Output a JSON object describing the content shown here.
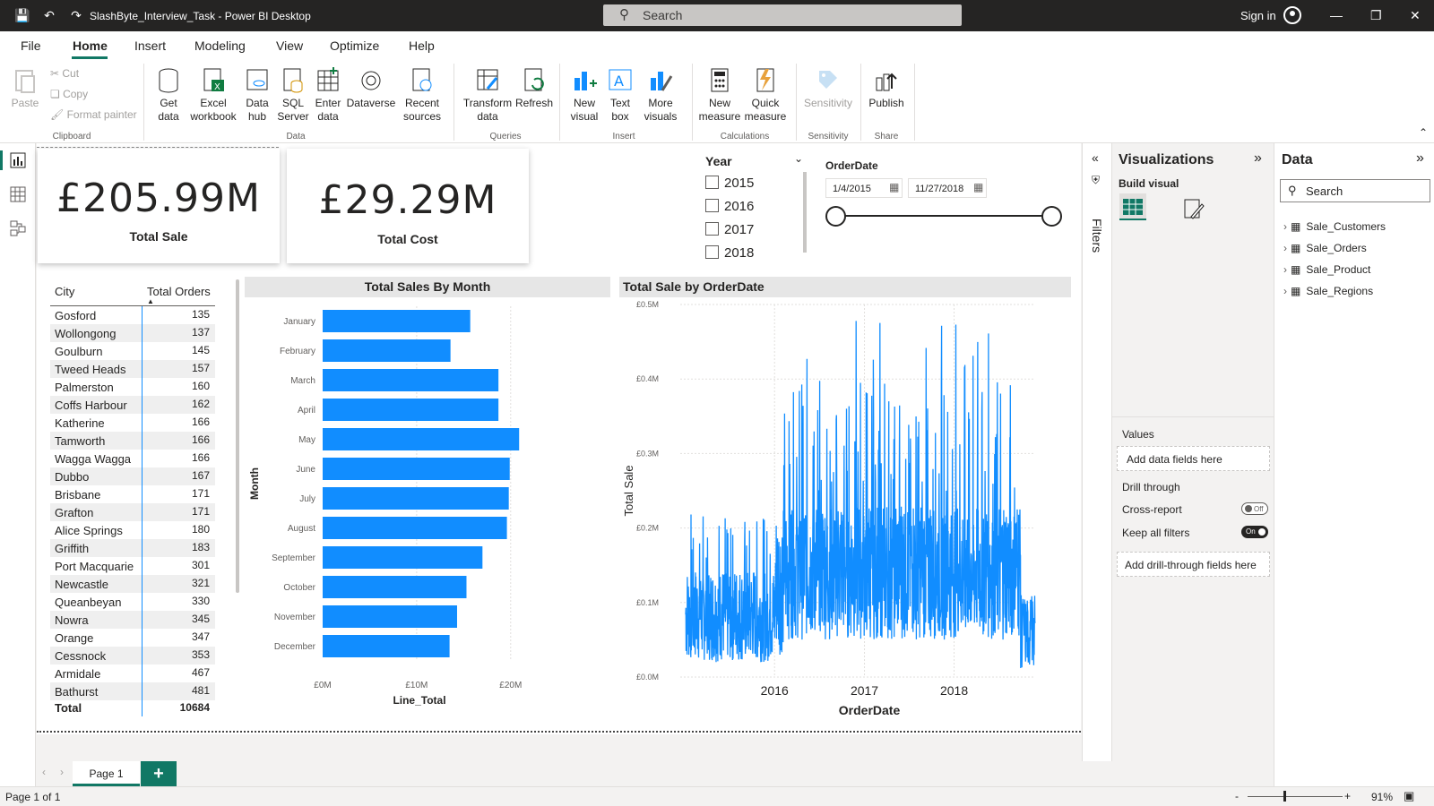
{
  "app": {
    "title": "SlashByte_Interview_Task - Power BI Desktop",
    "search_placeholder": "Search",
    "signin": "Sign in"
  },
  "menu": [
    "File",
    "Home",
    "Insert",
    "Modeling",
    "View",
    "Optimize",
    "Help"
  ],
  "ribbon": {
    "clipboard": {
      "paste": "Paste",
      "cut": "Cut",
      "copy": "Copy",
      "format_painter": "Format painter",
      "group": "Clipboard"
    },
    "data": {
      "get_data": "Get data",
      "excel": "Excel workbook",
      "data_hub": "Data hub",
      "sql": "SQL Server",
      "enter": "Enter data",
      "dataverse": "Dataverse",
      "recent": "Recent sources",
      "group": "Data"
    },
    "queries": {
      "transform": "Transform data",
      "refresh": "Refresh",
      "group": "Queries"
    },
    "insert": {
      "new_visual": "New visual",
      "text_box": "Text box",
      "more_visuals": "More visuals",
      "group": "Insert"
    },
    "calc": {
      "new_measure": "New measure",
      "quick_measure": "Quick measure",
      "group": "Calculations"
    },
    "sens": {
      "label": "Sensitivity",
      "group": "Sensitivity"
    },
    "share": {
      "publish": "Publish",
      "group": "Share"
    }
  },
  "cards": [
    {
      "value": "£205.99M",
      "label": "Total Sale"
    },
    {
      "value": "£29.29M",
      "label": "Total Cost"
    }
  ],
  "year_slicer": {
    "title": "Year",
    "items": [
      "2015",
      "2016",
      "2017",
      "2018"
    ]
  },
  "date_slicer": {
    "title": "OrderDate",
    "start": "1/4/2015",
    "end": "11/27/2018"
  },
  "table": {
    "headers": [
      "City",
      "Total Orders"
    ],
    "rows": [
      [
        "Gosford",
        "135"
      ],
      [
        "Wollongong",
        "137"
      ],
      [
        "Goulburn",
        "145"
      ],
      [
        "Tweed Heads",
        "157"
      ],
      [
        "Palmerston",
        "160"
      ],
      [
        "Coffs Harbour",
        "162"
      ],
      [
        "Katherine",
        "166"
      ],
      [
        "Tamworth",
        "166"
      ],
      [
        "Wagga Wagga",
        "166"
      ],
      [
        "Dubbo",
        "167"
      ],
      [
        "Brisbane",
        "171"
      ],
      [
        "Grafton",
        "171"
      ],
      [
        "Alice Springs",
        "180"
      ],
      [
        "Griffith",
        "183"
      ],
      [
        "Port Macquarie",
        "301"
      ],
      [
        "Newcastle",
        "321"
      ],
      [
        "Queanbeyan",
        "330"
      ],
      [
        "Nowra",
        "345"
      ],
      [
        "Orange",
        "347"
      ],
      [
        "Cessnock",
        "353"
      ],
      [
        "Armidale",
        "467"
      ],
      [
        "Bathurst",
        "481"
      ]
    ],
    "total_label": "Total",
    "total_value": "10684"
  },
  "chart_data": [
    {
      "type": "bar",
      "title": "Total Sales By Month",
      "ylabel": "Month",
      "xlabel": "Line_Total",
      "categories": [
        "January",
        "February",
        "March",
        "April",
        "May",
        "June",
        "July",
        "August",
        "September",
        "October",
        "November",
        "December"
      ],
      "values": [
        15.7,
        13.6,
        18.7,
        18.7,
        20.9,
        19.9,
        19.8,
        19.6,
        17.0,
        15.3,
        14.3,
        13.5
      ],
      "xticks": [
        "£0M",
        "£10M",
        "£20M"
      ],
      "xlim": [
        0,
        22.5
      ]
    },
    {
      "type": "line",
      "title": "Total Sale by OrderDate",
      "ylabel": "Total Sale",
      "xlabel": "OrderDate",
      "yticks": [
        "£0.0M",
        "£0.1M",
        "£0.2M",
        "£0.3M",
        "£0.4M",
        "£0.5M"
      ],
      "ylim": [
        0,
        0.5
      ],
      "xticks": [
        "2016",
        "2017",
        "2018"
      ],
      "xrange": [
        "2015-01-04",
        "2018-11-27"
      ]
    }
  ],
  "viz_pane": {
    "title": "Visualizations",
    "build": "Build visual",
    "values": "Values",
    "add_fields": "Add data fields here",
    "drill": "Drill through",
    "cross": "Cross-report",
    "cross_state": "Off",
    "keep": "Keep all filters",
    "keep_state": "On",
    "add_drill": "Add drill-through fields here"
  },
  "filters_label": "Filters",
  "data_pane": {
    "title": "Data",
    "search": "Search",
    "tables": [
      "Sale_Customers",
      "Sale_Orders",
      "Sale_Product",
      "Sale_Regions"
    ]
  },
  "pages": {
    "tab": "Page 1"
  },
  "status": {
    "page": "Page 1 of 1",
    "zoom": "91%"
  },
  "colors": {
    "accent": "#118dff",
    "brand": "#117865"
  }
}
